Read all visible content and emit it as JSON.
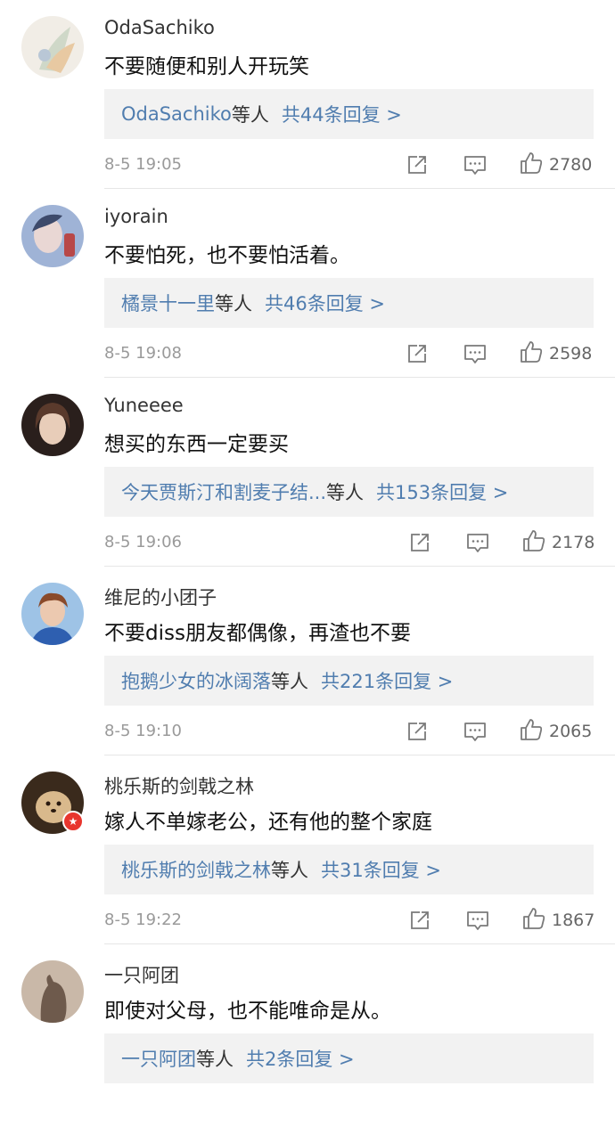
{
  "comments": [
    {
      "username": "OdaSachiko",
      "text": "不要随便和别人开玩笑",
      "reply_users": "OdaSachiko",
      "reply_etc": "等人",
      "reply_count": "共44条回复 >",
      "time": "8-5 19:05",
      "likes": "2780",
      "verified": false
    },
    {
      "username": "iyorain",
      "text": "不要怕死，也不要怕活着。",
      "reply_users": "橘景十一里",
      "reply_etc": "等人",
      "reply_count": "共46条回复 >",
      "time": "8-5 19:08",
      "likes": "2598",
      "verified": false
    },
    {
      "username": "Yuneeee",
      "text": "想买的东西一定要买",
      "reply_users": "今天贾斯汀和割麦子结...",
      "reply_etc": "等人",
      "reply_count": "共153条回复 >",
      "time": "8-5 19:06",
      "likes": "2178",
      "verified": false
    },
    {
      "username": "维尼的小团子",
      "text": "不要diss朋友都偶像，再渣也不要",
      "reply_users": "抱鹅少女的冰阔落",
      "reply_etc": "等人",
      "reply_count": "共221条回复 >",
      "time": "8-5 19:10",
      "likes": "2065",
      "verified": false
    },
    {
      "username": "桃乐斯的剑戟之林",
      "text": "嫁人不单嫁老公，还有他的整个家庭",
      "reply_users": "桃乐斯的剑戟之林",
      "reply_etc": "等人",
      "reply_count": "共31条回复 >",
      "time": "8-5 19:22",
      "likes": "1867",
      "verified": true
    },
    {
      "username": "一只阿团",
      "text": "即使对父母，也不能唯命是从。",
      "reply_users": "一只阿团",
      "reply_etc": "等人",
      "reply_count": "共2条回复 >",
      "time": "",
      "likes": "",
      "verified": false
    }
  ],
  "icons": {
    "share": "share-icon",
    "comment": "comment-icon",
    "like": "thumbs-up-icon",
    "verified": "verified-badge-icon"
  },
  "colors": {
    "link": "#507daf",
    "reply_bg": "#f2f2f2",
    "meta": "#9a9a9a",
    "verified": "#e8352d"
  }
}
